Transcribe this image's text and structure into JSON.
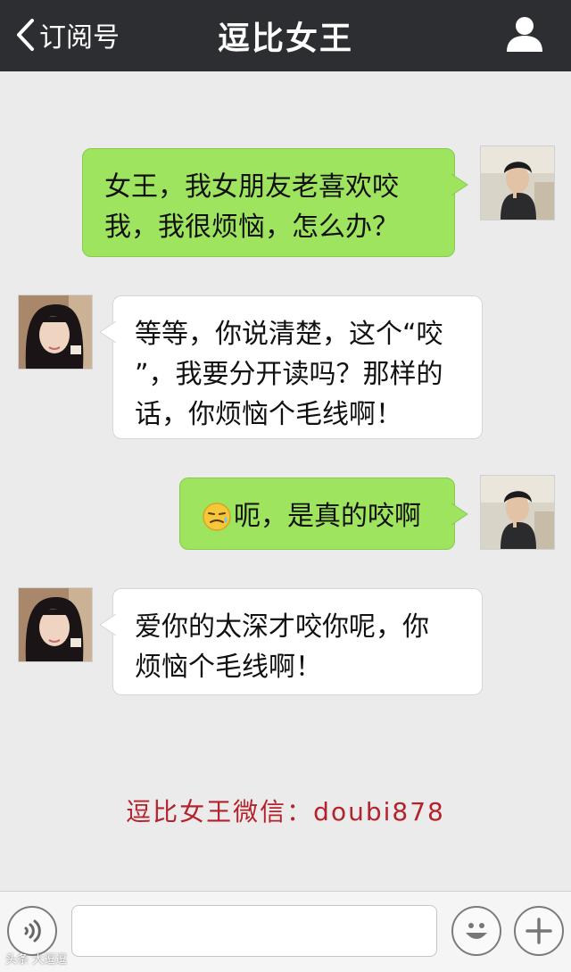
{
  "header": {
    "back_label": "订阅号",
    "title": "逗比女王"
  },
  "messages": [
    {
      "sender": "me",
      "lines": [
        "女王，我女朋友老喜欢咬",
        "我，我很烦恼，怎么办？"
      ]
    },
    {
      "sender": "them",
      "lines": [
        "等等，你说清楚，这个“咬",
        "”，我要分开读吗？那样的",
        "话，你烦恼个毛线啊！"
      ]
    },
    {
      "sender": "me",
      "emoji": "smirk-emoji",
      "text": "呃，是真的咬啊"
    },
    {
      "sender": "them",
      "lines": [
        "爱你的太深才咬你呢，你",
        "烦恼个毛线啊！"
      ]
    }
  ],
  "footer_ad": "逗比女王微信：doubi878",
  "input": {
    "placeholder": ""
  },
  "watermark": "头条 大逗逗",
  "colors": {
    "header_bg": "#2d2e31",
    "my_bubble": "#9ee45f",
    "their_bubble": "#ffffff",
    "ad_text": "#b4232c"
  }
}
